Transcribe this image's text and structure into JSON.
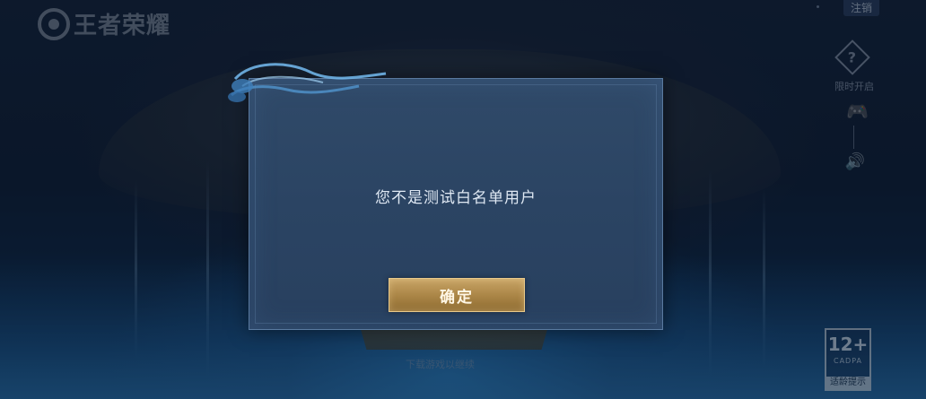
{
  "brand": {
    "logo_text": "王者荣耀"
  },
  "topbar": {
    "logout_label": "注销"
  },
  "side": {
    "help_glyph": "?",
    "toggle_label": "限时开启",
    "gamepad_glyph": "🎮",
    "volume_glyph": "🔊"
  },
  "background": {
    "caption": "下载游戏以继续"
  },
  "age_rating": {
    "age": "12+",
    "org": "CADPA",
    "tip": "适龄提示"
  },
  "dialog": {
    "message": "您不是测试白名单用户",
    "confirm_label": "确定"
  },
  "colors": {
    "dialog_bg": "#2b4463",
    "button_gold": "#a98445",
    "text_light": "#dfe8f3"
  }
}
